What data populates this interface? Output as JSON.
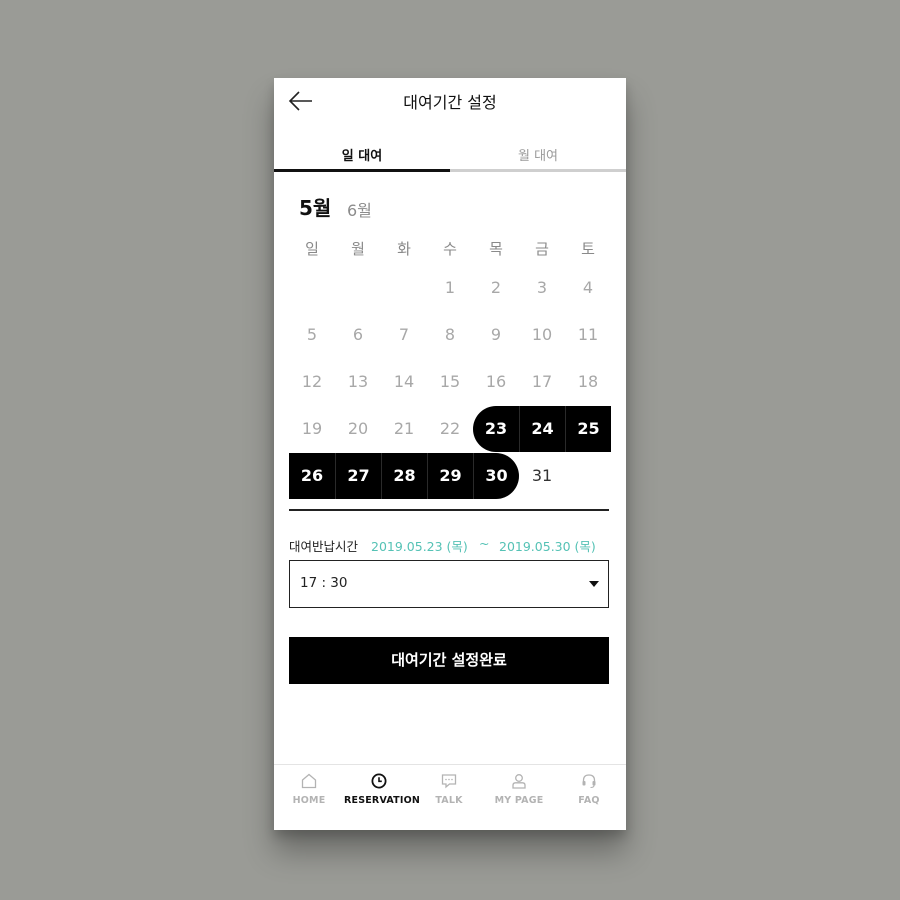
{
  "header": {
    "title": "대여기간 설정"
  },
  "tabs": [
    {
      "label": "일 대여",
      "active": true
    },
    {
      "label": "월 대여",
      "active": false
    }
  ],
  "calendar": {
    "current_month": "5월",
    "next_month": "6월",
    "weekdays": [
      "일",
      "월",
      "화",
      "수",
      "목",
      "금",
      "토"
    ],
    "rows": [
      [
        "",
        "",
        "",
        "1",
        "2",
        "3",
        "4"
      ],
      [
        "5",
        "6",
        "7",
        "8",
        "9",
        "10",
        "11"
      ],
      [
        "12",
        "13",
        "14",
        "15",
        "16",
        "17",
        "18"
      ],
      [
        "19",
        "20",
        "21",
        "22",
        "23",
        "24",
        "25"
      ],
      [
        "26",
        "27",
        "28",
        "29",
        "30",
        "31",
        ""
      ]
    ],
    "selected_start": 23,
    "selected_end": 30,
    "selectable_after": 30
  },
  "rental": {
    "label": "대여반납시간",
    "start": "2019.05.23 (목)",
    "separator": "~",
    "end": "2019.05.30 (목)",
    "time_value": "17 : 30"
  },
  "confirm_label": "대여기간 설정완료",
  "nav": [
    {
      "label": "HOME",
      "icon": "home-icon",
      "active": false
    },
    {
      "label": "RESERVATION",
      "icon": "clock-icon",
      "active": true
    },
    {
      "label": "TALK",
      "icon": "chat-icon",
      "active": false
    },
    {
      "label": "MY PAGE",
      "icon": "user-icon",
      "active": false
    },
    {
      "label": "FAQ",
      "icon": "headset-icon",
      "active": false
    }
  ],
  "colors": {
    "accent": "#55c2b5",
    "selected": "#000000",
    "muted": "#a8a8a8"
  }
}
